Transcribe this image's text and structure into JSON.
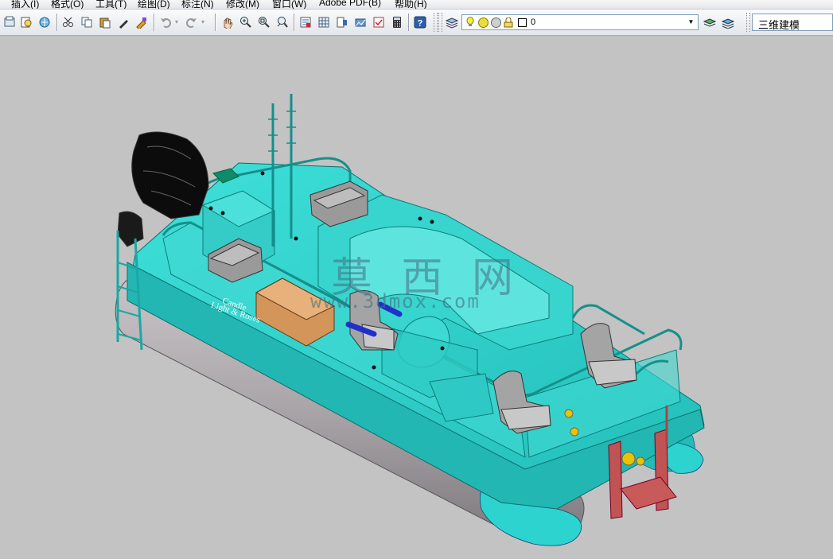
{
  "menu": {
    "items": [
      "插入(I)",
      "格式(O)",
      "工具(T)",
      "绘图(D)",
      "标注(N)",
      "修改(M)",
      "窗口(W)",
      "Adobe PDF(B)",
      "帮助(H)"
    ]
  },
  "toolbar": {
    "layer_value": "0",
    "workspace_value": "三维建模"
  },
  "canvas": {
    "watermark_cn": "莫 西 网",
    "watermark_url": "www.3dmox.com",
    "hull_text_line1": "Candle",
    "hull_text_line2": "Light & Roses"
  },
  "colors": {
    "background": "#c3c3c3",
    "deck": "#33d1cc",
    "motor": "#111111",
    "pontoon": "#a9a4a8"
  }
}
